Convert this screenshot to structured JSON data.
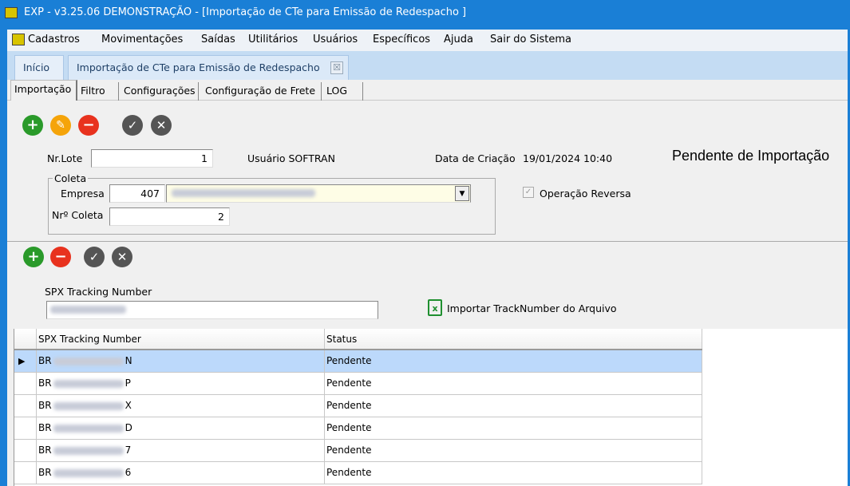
{
  "window": {
    "title": "EXP - v3.25.06   DEMONSTRAÇÃO - [Importação de CTe para Emissão de Redespacho ]"
  },
  "menu": [
    "Cadastros",
    "Movimentações",
    "Saídas",
    "Utilitários",
    "Usuários",
    "Específicos",
    "Ajuda",
    "Sair do Sistema"
  ],
  "doc_tabs": {
    "home": "Início",
    "active": "Importação de CTe para Emissão de Redespacho",
    "close": "☒"
  },
  "sub_tabs": [
    "Importação",
    "Filtro",
    "Configurações",
    "Configuração de Frete",
    "LOG"
  ],
  "form": {
    "lote_label": "Nr.Lote",
    "lote_value": "1",
    "usuario": "Usuário SOFTRAN",
    "data_label": "Data de Criação",
    "data_value": "19/01/2024 10:40",
    "status": "Pendente de Importação",
    "coleta_group": "Coleta",
    "empresa_label": "Empresa",
    "empresa_code": "407",
    "coleta_label": "Nrº Coleta",
    "coleta_value": "2",
    "reversa_label": "Operação Reversa",
    "reversa_checked": true
  },
  "tracking": {
    "label": "SPX Tracking Number",
    "import_label": "Importar TrackNumber do Arquivo"
  },
  "grid": {
    "columns": [
      "SPX Tracking Number",
      "Status"
    ],
    "rows": [
      {
        "prefix": "BR",
        "suffix": "N",
        "status": "Pendente"
      },
      {
        "prefix": "BR",
        "suffix": "P",
        "status": "Pendente"
      },
      {
        "prefix": "BR",
        "suffix": "X",
        "status": "Pendente"
      },
      {
        "prefix": "BR",
        "suffix": "D",
        "status": "Pendente"
      },
      {
        "prefix": "BR",
        "suffix": "7",
        "status": "Pendente"
      },
      {
        "prefix": "BR",
        "suffix": "6",
        "status": "Pendente"
      }
    ]
  }
}
